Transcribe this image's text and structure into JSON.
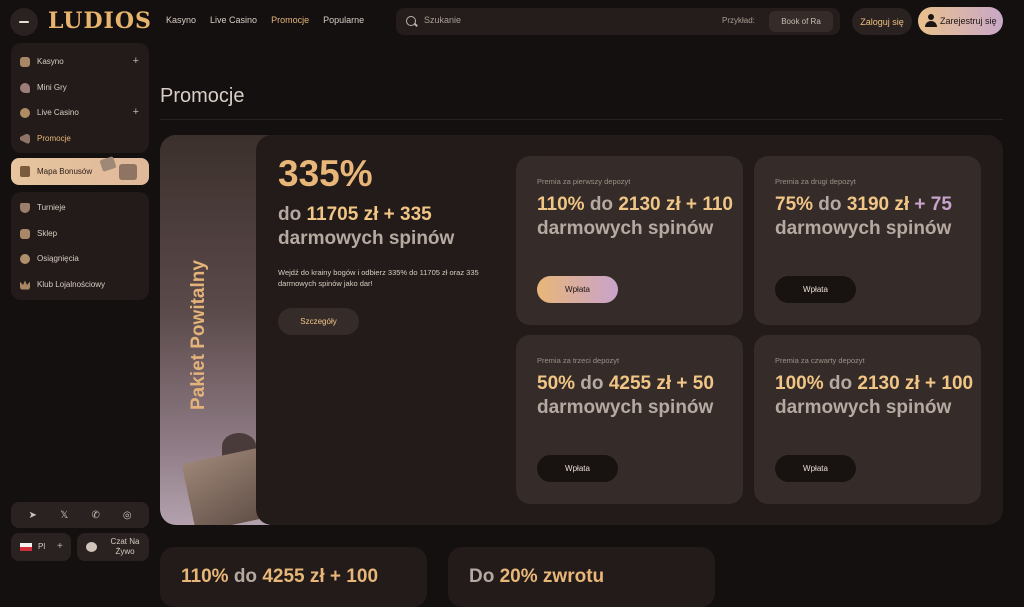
{
  "header": {
    "logo": "LUDIOS",
    "nav": [
      "Kasyno",
      "Live Casino",
      "Promocje",
      "Popularne"
    ],
    "active_nav": "Promocje",
    "search_placeholder": "Szukanie",
    "search_example_label": "Przykład:",
    "search_example_value": "Book of Ra",
    "login": "Zaloguj się",
    "register": "Zarejestruj się"
  },
  "sidebar": {
    "items": [
      {
        "label": "Kasyno",
        "icon": "dice-icon",
        "expand": "+"
      },
      {
        "label": "Mini Gry",
        "icon": "rocket-icon",
        "expand": ""
      },
      {
        "label": "Live Casino",
        "icon": "chip-icon",
        "expand": "+"
      },
      {
        "label": "Promocje",
        "icon": "megaphone-icon",
        "expand": ""
      }
    ],
    "bonus_map": "Mapa Bonusów",
    "items2": [
      {
        "label": "Turnieje",
        "icon": "trophy-icon"
      },
      {
        "label": "Sklep",
        "icon": "bag-icon"
      },
      {
        "label": "Osiągnięcia",
        "icon": "badge-icon"
      },
      {
        "label": "Klub Lojalnościowy",
        "icon": "crown-icon"
      }
    ],
    "social": [
      "telegram-icon",
      "x-icon",
      "whatsapp-icon",
      "instagram-icon"
    ],
    "language": "Pl",
    "language_plus": "+",
    "chat": "Czat Na Żywo"
  },
  "main": {
    "title": "Promocje",
    "welcome": {
      "side_label": "Pakiet Powitalny",
      "percent": "335%",
      "sub_prefix": "do ",
      "sub_amount": "11705 zł",
      "sub_plus": " + ",
      "sub_spins_num": "335",
      "sub_spins_text": "darmowych spinów",
      "description": "Wejdź do krainy bogów i odbierz 335% do 11705 zł oraz 335 darmowych spinów jako dar!",
      "details_button": "Szczegóły"
    },
    "deposits": [
      {
        "label": "Premia za pierwszy depozyt",
        "pct": "110%",
        "amount": "2130 zł",
        "spins": "110",
        "button": "Wpłata"
      },
      {
        "label": "Premia za drugi depozyt",
        "pct": "75%",
        "amount": "3190 zł",
        "spins": "75",
        "button": "Wpłata"
      },
      {
        "label": "Premia za trzeci depozyt",
        "pct": "50%",
        "amount": "4255 zł",
        "spins": "50",
        "button": "Wpłata"
      },
      {
        "label": "Premia za czwarty depozyt",
        "pct": "100%",
        "amount": "2130 zł",
        "spins": "100",
        "button": "Wpłata"
      }
    ],
    "common": {
      "do": " do ",
      "plus": " + ",
      "spins_text": " darmowych spinów"
    },
    "bottom_cards": [
      {
        "gold1": "110%",
        "dim": " do ",
        "gold2": "4255 zł + 100"
      },
      {
        "gold1": "",
        "dim": "Do ",
        "gold2": "20% zwrotu"
      }
    ],
    "colors": {
      "accent": "#e8b678",
      "lilac": "#c8a3cc",
      "bg": "#141010",
      "card": "#221b19"
    }
  }
}
